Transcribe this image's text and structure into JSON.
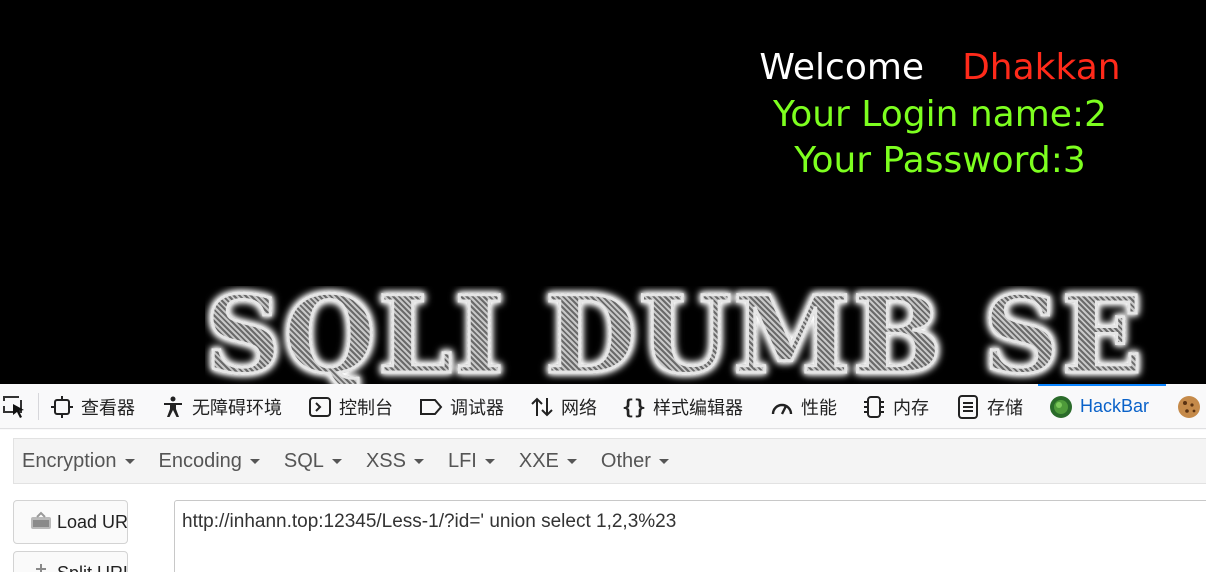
{
  "page": {
    "welcome": "Welcome",
    "username": "Dhakkan",
    "login_line": "Your Login name:2",
    "password_line": "Your Password:3",
    "banner": "SQLI DUMB SE"
  },
  "devtools": {
    "tabs": [
      {
        "label": "查看器",
        "icon": "inspector-icon"
      },
      {
        "label": "无障碍环境",
        "icon": "accessibility-icon"
      },
      {
        "label": "控制台",
        "icon": "console-icon"
      },
      {
        "label": "调试器",
        "icon": "debugger-icon"
      },
      {
        "label": "网络",
        "icon": "network-icon"
      },
      {
        "label": "样式编辑器",
        "icon": "style-editor-icon"
      },
      {
        "label": "性能",
        "icon": "performance-icon"
      },
      {
        "label": "内存",
        "icon": "memory-icon"
      },
      {
        "label": "存储",
        "icon": "storage-icon"
      },
      {
        "label": "HackBar",
        "icon": "hackbar-icon",
        "active": true
      }
    ]
  },
  "hackbar": {
    "menus": [
      "Encryption",
      "Encoding",
      "SQL",
      "XSS",
      "LFI",
      "XXE",
      "Other"
    ],
    "load_url": "Load URL",
    "split_url": "Split URL",
    "url_value": "http://inhann.top:12345/Less-1/?id=' union select 1,2,3%23"
  },
  "colors": {
    "welcome": "#ffffff",
    "username": "#ff2a1a",
    "info": "#7dff1f",
    "active_tab": "#0a62c9"
  }
}
